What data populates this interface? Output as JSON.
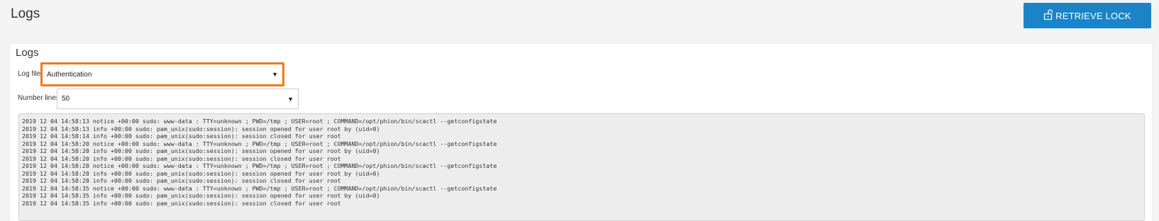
{
  "header": {
    "title": "Logs",
    "retrieve_lock_label": "RETRIEVE LOCK",
    "retrieve_lock_icon": "unlock-icon",
    "accent_color": "#1a84c7"
  },
  "card": {
    "title": "Logs",
    "log_file": {
      "label": "Log file",
      "selected": "Authentication",
      "highlight_color": "#f07a1a"
    },
    "number_lines": {
      "label": "Number lines",
      "selected": "50"
    },
    "log_lines": [
      "2019 12 04 14:58:13 notice +00:00 sudo: www-data : TTY=unknown ; PWD=/tmp ; USER=root ; COMMAND=/opt/phion/bin/scactl --getconfigstate",
      "2019 12 04 14:58:13 info +00:00 sudo: pam_unix(sudo:session): session opened for user root by (uid=0)",
      "2019 12 04 14:58:14 info +00:00 sudo: pam_unix(sudo:session): session closed for user root",
      "2019 12 04 14:58:20 notice +00:00 sudo: www-data : TTY=unknown ; PWD=/tmp ; USER=root ; COMMAND=/opt/phion/bin/scactl --getconfigstate",
      "2019 12 04 14:58:20 info +00:00 sudo: pam_unix(sudo:session): session opened for user root by (uid=0)",
      "2019 12 04 14:58:20 info +00:00 sudo: pam_unix(sudo:session): session closed for user root",
      "2019 12 04 14:58:28 notice +00:00 sudo: www-data : TTY=unknown ; PWD=/tmp ; USER=root ; COMMAND=/opt/phion/bin/scactl --getconfigstate",
      "2019 12 04 14:58:28 info +00:00 sudo: pam_unix(sudo:session): session opened for user root by (uid=0)",
      "2019 12 04 14:58:28 info +00:00 sudo: pam_unix(sudo:session): session closed for user root",
      "2019 12 04 14:58:35 notice +00:00 sudo: www-data : TTY=unknown ; PWD=/tmp ; USER=root ; COMMAND=/opt/phion/bin/scactl --getconfigstate",
      "2019 12 04 14:58:35 info +00:00 sudo: pam_unix(sudo:session): session opened for user root by (uid=0)",
      "2019 12 04 14:58:35 info +00:00 sudo: pam_unix(sudo:session): session closed for user root"
    ]
  }
}
